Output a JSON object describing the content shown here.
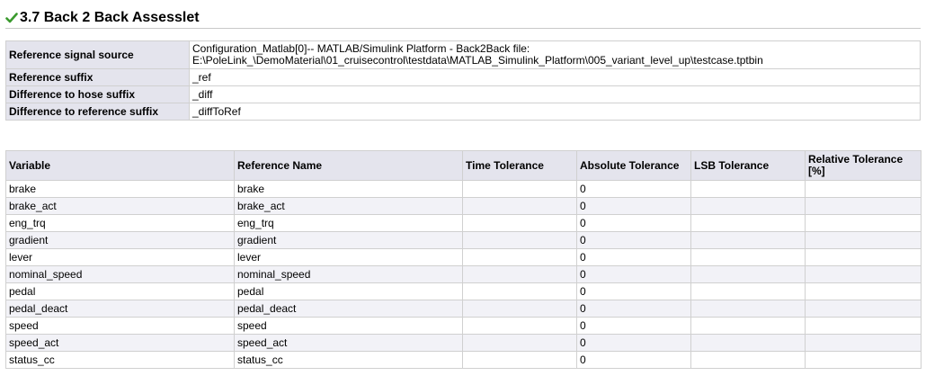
{
  "section": {
    "title": "3.7 Back 2 Back Assesslet",
    "status_icon": "check-icon",
    "status_color": "#3a9a2e"
  },
  "info": {
    "rows": [
      {
        "label": "Reference signal source",
        "value_line1": "Configuration_Matlab[0]-- MATLAB/Simulink Platform - Back2Back file:",
        "value_line2": "E:\\PoleLink_\\DemoMaterial\\01_cruisecontrol\\testdata\\MATLAB_Simulink_Platform\\005_variant_level_up\\testcase.tptbin"
      },
      {
        "label": "Reference suffix",
        "value": "_ref"
      },
      {
        "label": "Difference to hose suffix",
        "value": "_diff"
      },
      {
        "label": "Difference to reference suffix",
        "value": "_diffToRef"
      }
    ]
  },
  "variables": {
    "headers": [
      "Variable",
      "Reference Name",
      "Time Tolerance",
      "Absolute Tolerance",
      "LSB Tolerance",
      "Relative Tolerance [%]"
    ],
    "rows": [
      {
        "variable": "brake",
        "reference": "brake",
        "time_tol": "",
        "abs_tol": "0",
        "lsb_tol": "",
        "rel_tol": ""
      },
      {
        "variable": "brake_act",
        "reference": "brake_act",
        "time_tol": "",
        "abs_tol": "0",
        "lsb_tol": "",
        "rel_tol": ""
      },
      {
        "variable": "eng_trq",
        "reference": "eng_trq",
        "time_tol": "",
        "abs_tol": "0",
        "lsb_tol": "",
        "rel_tol": ""
      },
      {
        "variable": "gradient",
        "reference": "gradient",
        "time_tol": "",
        "abs_tol": "0",
        "lsb_tol": "",
        "rel_tol": ""
      },
      {
        "variable": "lever",
        "reference": "lever",
        "time_tol": "",
        "abs_tol": "0",
        "lsb_tol": "",
        "rel_tol": ""
      },
      {
        "variable": "nominal_speed",
        "reference": "nominal_speed",
        "time_tol": "",
        "abs_tol": "0",
        "lsb_tol": "",
        "rel_tol": ""
      },
      {
        "variable": "pedal",
        "reference": "pedal",
        "time_tol": "",
        "abs_tol": "0",
        "lsb_tol": "",
        "rel_tol": ""
      },
      {
        "variable": "pedal_deact",
        "reference": "pedal_deact",
        "time_tol": "",
        "abs_tol": "0",
        "lsb_tol": "",
        "rel_tol": ""
      },
      {
        "variable": "speed",
        "reference": "speed",
        "time_tol": "",
        "abs_tol": "0",
        "lsb_tol": "",
        "rel_tol": ""
      },
      {
        "variable": "speed_act",
        "reference": "speed_act",
        "time_tol": "",
        "abs_tol": "0",
        "lsb_tol": "",
        "rel_tol": ""
      },
      {
        "variable": "status_cc",
        "reference": "status_cc",
        "time_tol": "",
        "abs_tol": "0",
        "lsb_tol": "",
        "rel_tol": ""
      }
    ]
  }
}
